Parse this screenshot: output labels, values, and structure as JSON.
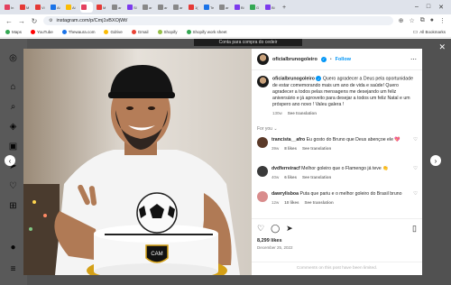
{
  "browser": {
    "tabs": [
      {
        "label": "In",
        "color": "#e4405f"
      },
      {
        "label": "M",
        "color": "#e53935"
      },
      {
        "label": "Vi",
        "color": "#e53935"
      },
      {
        "label": "Ai",
        "color": "#1a73e8"
      },
      {
        "label": "Ai",
        "color": "#fbbc04"
      },
      {
        "label": "",
        "color": "#e4405f",
        "active": true
      },
      {
        "label": "M",
        "color": "#e53935"
      },
      {
        "label": "ar",
        "color": "#888888"
      },
      {
        "label": "Sl",
        "color": "#7c3aed"
      },
      {
        "label": "ar",
        "color": "#888888"
      },
      {
        "label": "ar",
        "color": "#888888"
      },
      {
        "label": "ar",
        "color": "#888888"
      },
      {
        "label": "1(",
        "color": "#e53935"
      },
      {
        "label": "Te",
        "color": "#1a73e8"
      },
      {
        "label": "ar",
        "color": "#888888"
      },
      {
        "label": "Bi",
        "color": "#7c3aed"
      },
      {
        "label": "G",
        "color": "#34a853"
      },
      {
        "label": "Bi",
        "color": "#7c3aed"
      }
    ],
    "url": "instagram.com/p/Cmj1vBXOjWt/",
    "bookmarks": [
      {
        "label": "Maps",
        "color": "#34a853"
      },
      {
        "label": "YouTube",
        "color": "#ff0000"
      },
      {
        "label": "Thewaura.com",
        "color": "#1a73e8"
      },
      {
        "label": "Gdrive",
        "color": "#fbbc04"
      },
      {
        "label": "Gmail",
        "color": "#ea4335"
      },
      {
        "label": "Shopify",
        "color": "#95bf47"
      },
      {
        "label": "Shopify work sheet",
        "color": "#34a853"
      }
    ],
    "all_bookmarks": "All Bookmarks"
  },
  "page": {
    "banner": "Conta para compra do cedeir"
  },
  "post": {
    "username": "oficialbrunogoleiro",
    "follow_label": "Follow",
    "caption": "Quero agradecer a Deus pela oportunidade de estar comemorando mais um ano de vida e saúde! Quero agradecer a todos pelas mensagens me desejando um feliz aniversário e já aproveito para desejar a todos um feliz Natal e um próspero ano novo ! Valeu galera !",
    "caption_age": "130w",
    "see_translation": "See translation",
    "for_you": "For you",
    "comments": [
      {
        "user": "trancista__afro",
        "text": "Eu gosto do Bruno que Deus abençoe ele 💖",
        "age": "39w",
        "likes": "8 likes",
        "action": "See translation",
        "color": "#5b3a29"
      },
      {
        "user": "dvdferreiracf",
        "text": "Melhor goleiro que o Flamengo já teve 👏",
        "age": "40w",
        "likes": "6 likes",
        "action": "See translation",
        "color": "#3a3a3a"
      },
      {
        "user": "dawrylisboa",
        "text": "Puta que pariu e o melhor goleiro do Brasil bruno",
        "age": "12w",
        "likes": "10 likes",
        "action": "See translation",
        "color": "#d98c8c"
      }
    ],
    "likes": "8,299 likes",
    "date": "December 25, 2022",
    "comments_limited": "Comments on this post have been limited."
  },
  "colors": {
    "instagram_blue": "#0095f6",
    "overlay": "#000000"
  }
}
